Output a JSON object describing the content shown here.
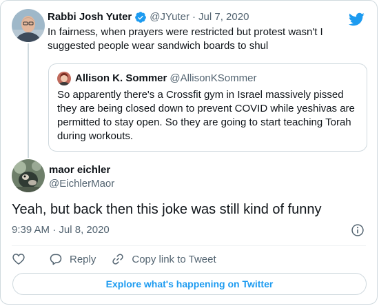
{
  "parent_tweet": {
    "author_name": "Rabbi Josh Yuter",
    "author_handle": "@JYuter",
    "separator": "·",
    "date": "Jul 7, 2020",
    "verified_icon": "verified-badge-icon",
    "text": "In fairness, when prayers were restricted but protest wasn't I suggested people wear sandwich boards to shul"
  },
  "quoted_tweet": {
    "author_name": "Allison K. Sommer",
    "author_handle": "@AllisonKSommer",
    "text": "So apparently there's a Crossfit gym in Israel massively pissed they are being closed down to prevent COVID while yeshivas are permitted to stay open. So they are going to start teaching Torah during workouts."
  },
  "main_tweet": {
    "author_name": "maor eichler",
    "author_handle": "@EichlerMaor",
    "text": "Yeah, but back then this joke was still kind of funny",
    "time": "9:39 AM",
    "time_separator": "·",
    "date": "Jul 8, 2020"
  },
  "actions": {
    "like_icon": "heart-icon",
    "reply_label": "Reply",
    "copy_link_label": "Copy link to Tweet"
  },
  "explore_label": "Explore what's happening on Twitter",
  "colors": {
    "accent": "#1d9bf0",
    "text_primary": "#0f1419",
    "text_secondary": "#536471",
    "border": "#cfd9de"
  }
}
